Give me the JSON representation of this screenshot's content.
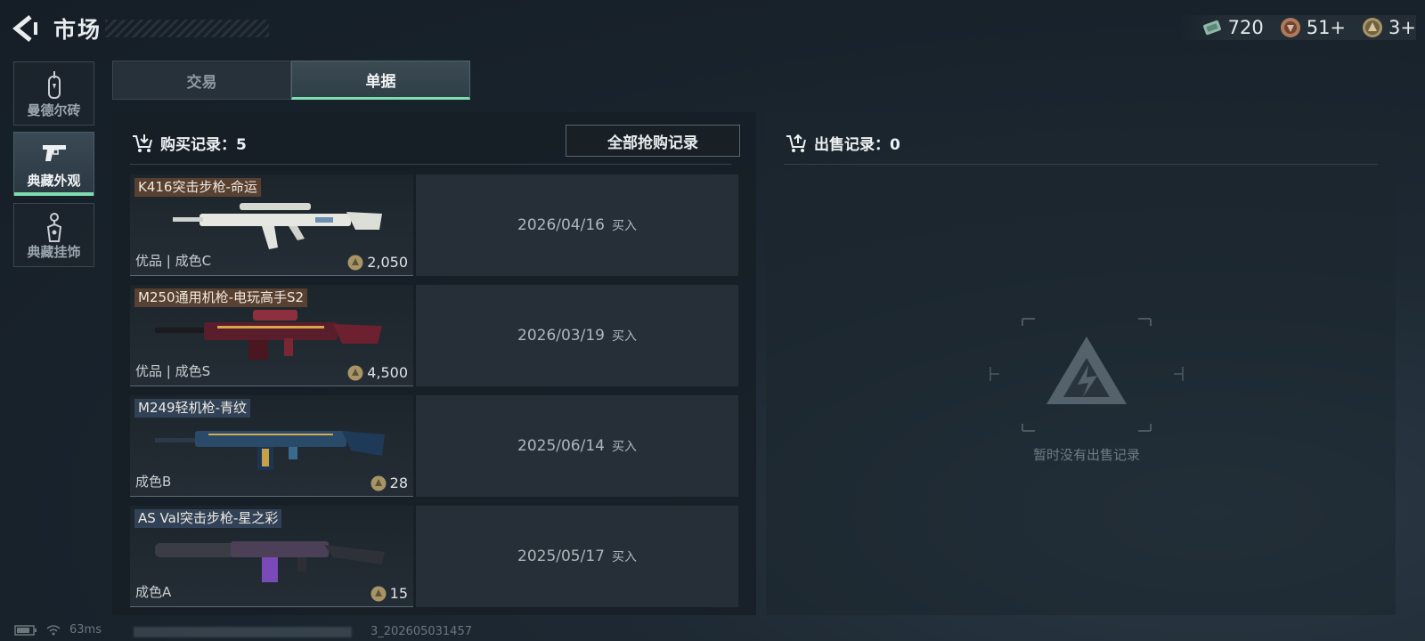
{
  "header": {
    "title": "市场",
    "currencies": [
      {
        "icon": "cash-ticket-icon",
        "value": "720"
      },
      {
        "icon": "bronze-badge-icon",
        "value": "51+"
      },
      {
        "icon": "gold-coin-icon",
        "value": "3+"
      }
    ]
  },
  "sidebar": {
    "items": [
      {
        "label": "曼德尔砖",
        "icon": "brick-icon",
        "active": false
      },
      {
        "label": "典藏外观",
        "icon": "pistol-icon",
        "active": true
      },
      {
        "label": "典藏挂饰",
        "icon": "charm-tag-icon",
        "active": false
      }
    ]
  },
  "tabs": [
    {
      "label": "交易",
      "active": false
    },
    {
      "label": "单据",
      "active": true
    }
  ],
  "purchase": {
    "heading": "购买记录：5",
    "grab_all_label": "全部抢购记录",
    "records": [
      {
        "name": "K416突击步枪-命运",
        "name_style": "gold",
        "quality": "优品 | 成色C",
        "price": "2,050",
        "date": "2026/04/16",
        "action": "买入"
      },
      {
        "name": "M250通用机枪-电玩高手S2",
        "name_style": "gold",
        "quality": "优品 | 成色S",
        "price": "4,500",
        "date": "2026/03/19",
        "action": "买入"
      },
      {
        "name": "M249轻机枪-青纹",
        "name_style": "blue",
        "quality": "成色B",
        "price": "28",
        "date": "2025/06/14",
        "action": "买入"
      },
      {
        "name": "AS Val突击步枪-星之彩",
        "name_style": "blue",
        "quality": "成色A",
        "price": "15",
        "date": "2025/05/17",
        "action": "买入"
      }
    ]
  },
  "sales": {
    "heading": "出售记录：0",
    "empty_text": "暂时没有出售记录"
  },
  "status": {
    "ping": "63ms",
    "build": "3_202605031457"
  },
  "colors": {
    "accent": "#7fdcb0",
    "bg": "#18222b"
  }
}
